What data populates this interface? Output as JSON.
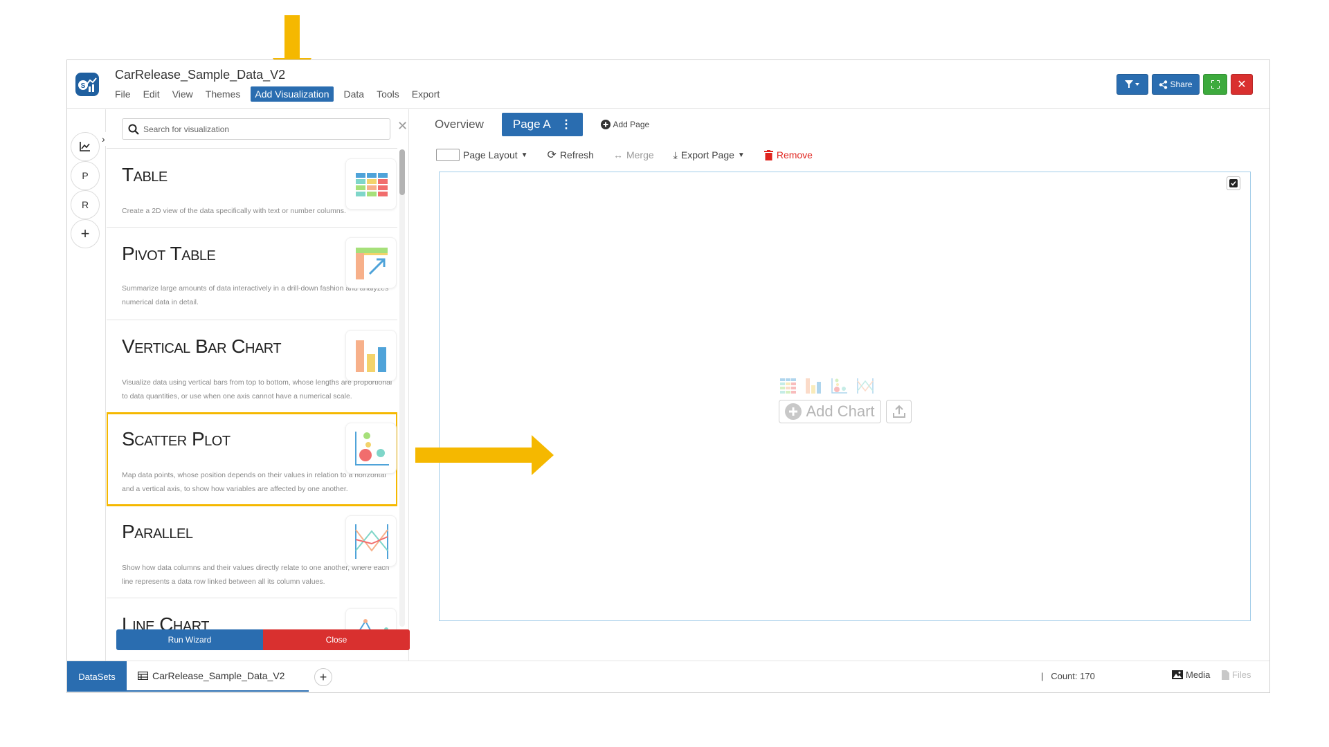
{
  "app": {
    "title": "CarRelease_Sample_Data_V2",
    "menu": [
      "File",
      "Edit",
      "View",
      "Themes",
      "Add Visualization",
      "Data",
      "Tools",
      "Export"
    ],
    "active_menu": "Add Visualization",
    "share_label": "Share"
  },
  "rail": {
    "items": [
      "P",
      "R",
      "+"
    ]
  },
  "viz_panel": {
    "search_placeholder": "Search for visualization",
    "items": [
      {
        "title": "Table",
        "description": "Create a 2D view of the data specifically with text or number columns."
      },
      {
        "title": "Pivot Table",
        "description": "Summarize large amounts of data interactively in a drill-down fashion and analyzes numerical data in detail."
      },
      {
        "title": "Vertical Bar Chart",
        "description": "Visualize data using vertical bars from top to bottom, whose lengths are proportional to data quantities, or use when one axis cannot have a numerical scale."
      },
      {
        "title": "Scatter Plot",
        "description": "Map data points, whose position depends on their values in relation to a horizontal and a vertical axis, to show how variables are affected by one another."
      },
      {
        "title": "Parallel",
        "description": "Show how data columns and their values directly relate to one another, where each line represents a data row linked between all its column values."
      },
      {
        "title": "Line Chart",
        "description": ""
      }
    ],
    "run_wizard_label": "Run Wizard",
    "close_label": "Close"
  },
  "page": {
    "tabs": {
      "overview": "Overview",
      "active": "Page A",
      "add": "Add Page"
    },
    "toolbar": {
      "layout": "Page Layout",
      "refresh": "Refresh",
      "merge": "Merge",
      "export": "Export Page",
      "remove": "Remove"
    },
    "add_chart_label": "Add Chart"
  },
  "status": {
    "datasets_label": "DataSets",
    "dataset_name": "CarRelease_Sample_Data_V2",
    "count": "|   Count: 170",
    "media_label": "Media",
    "files_label": "Files"
  },
  "colors": {
    "primary": "#2a6db0",
    "success": "#3daa3d",
    "danger": "#d9302f",
    "highlight": "#f5b800"
  }
}
